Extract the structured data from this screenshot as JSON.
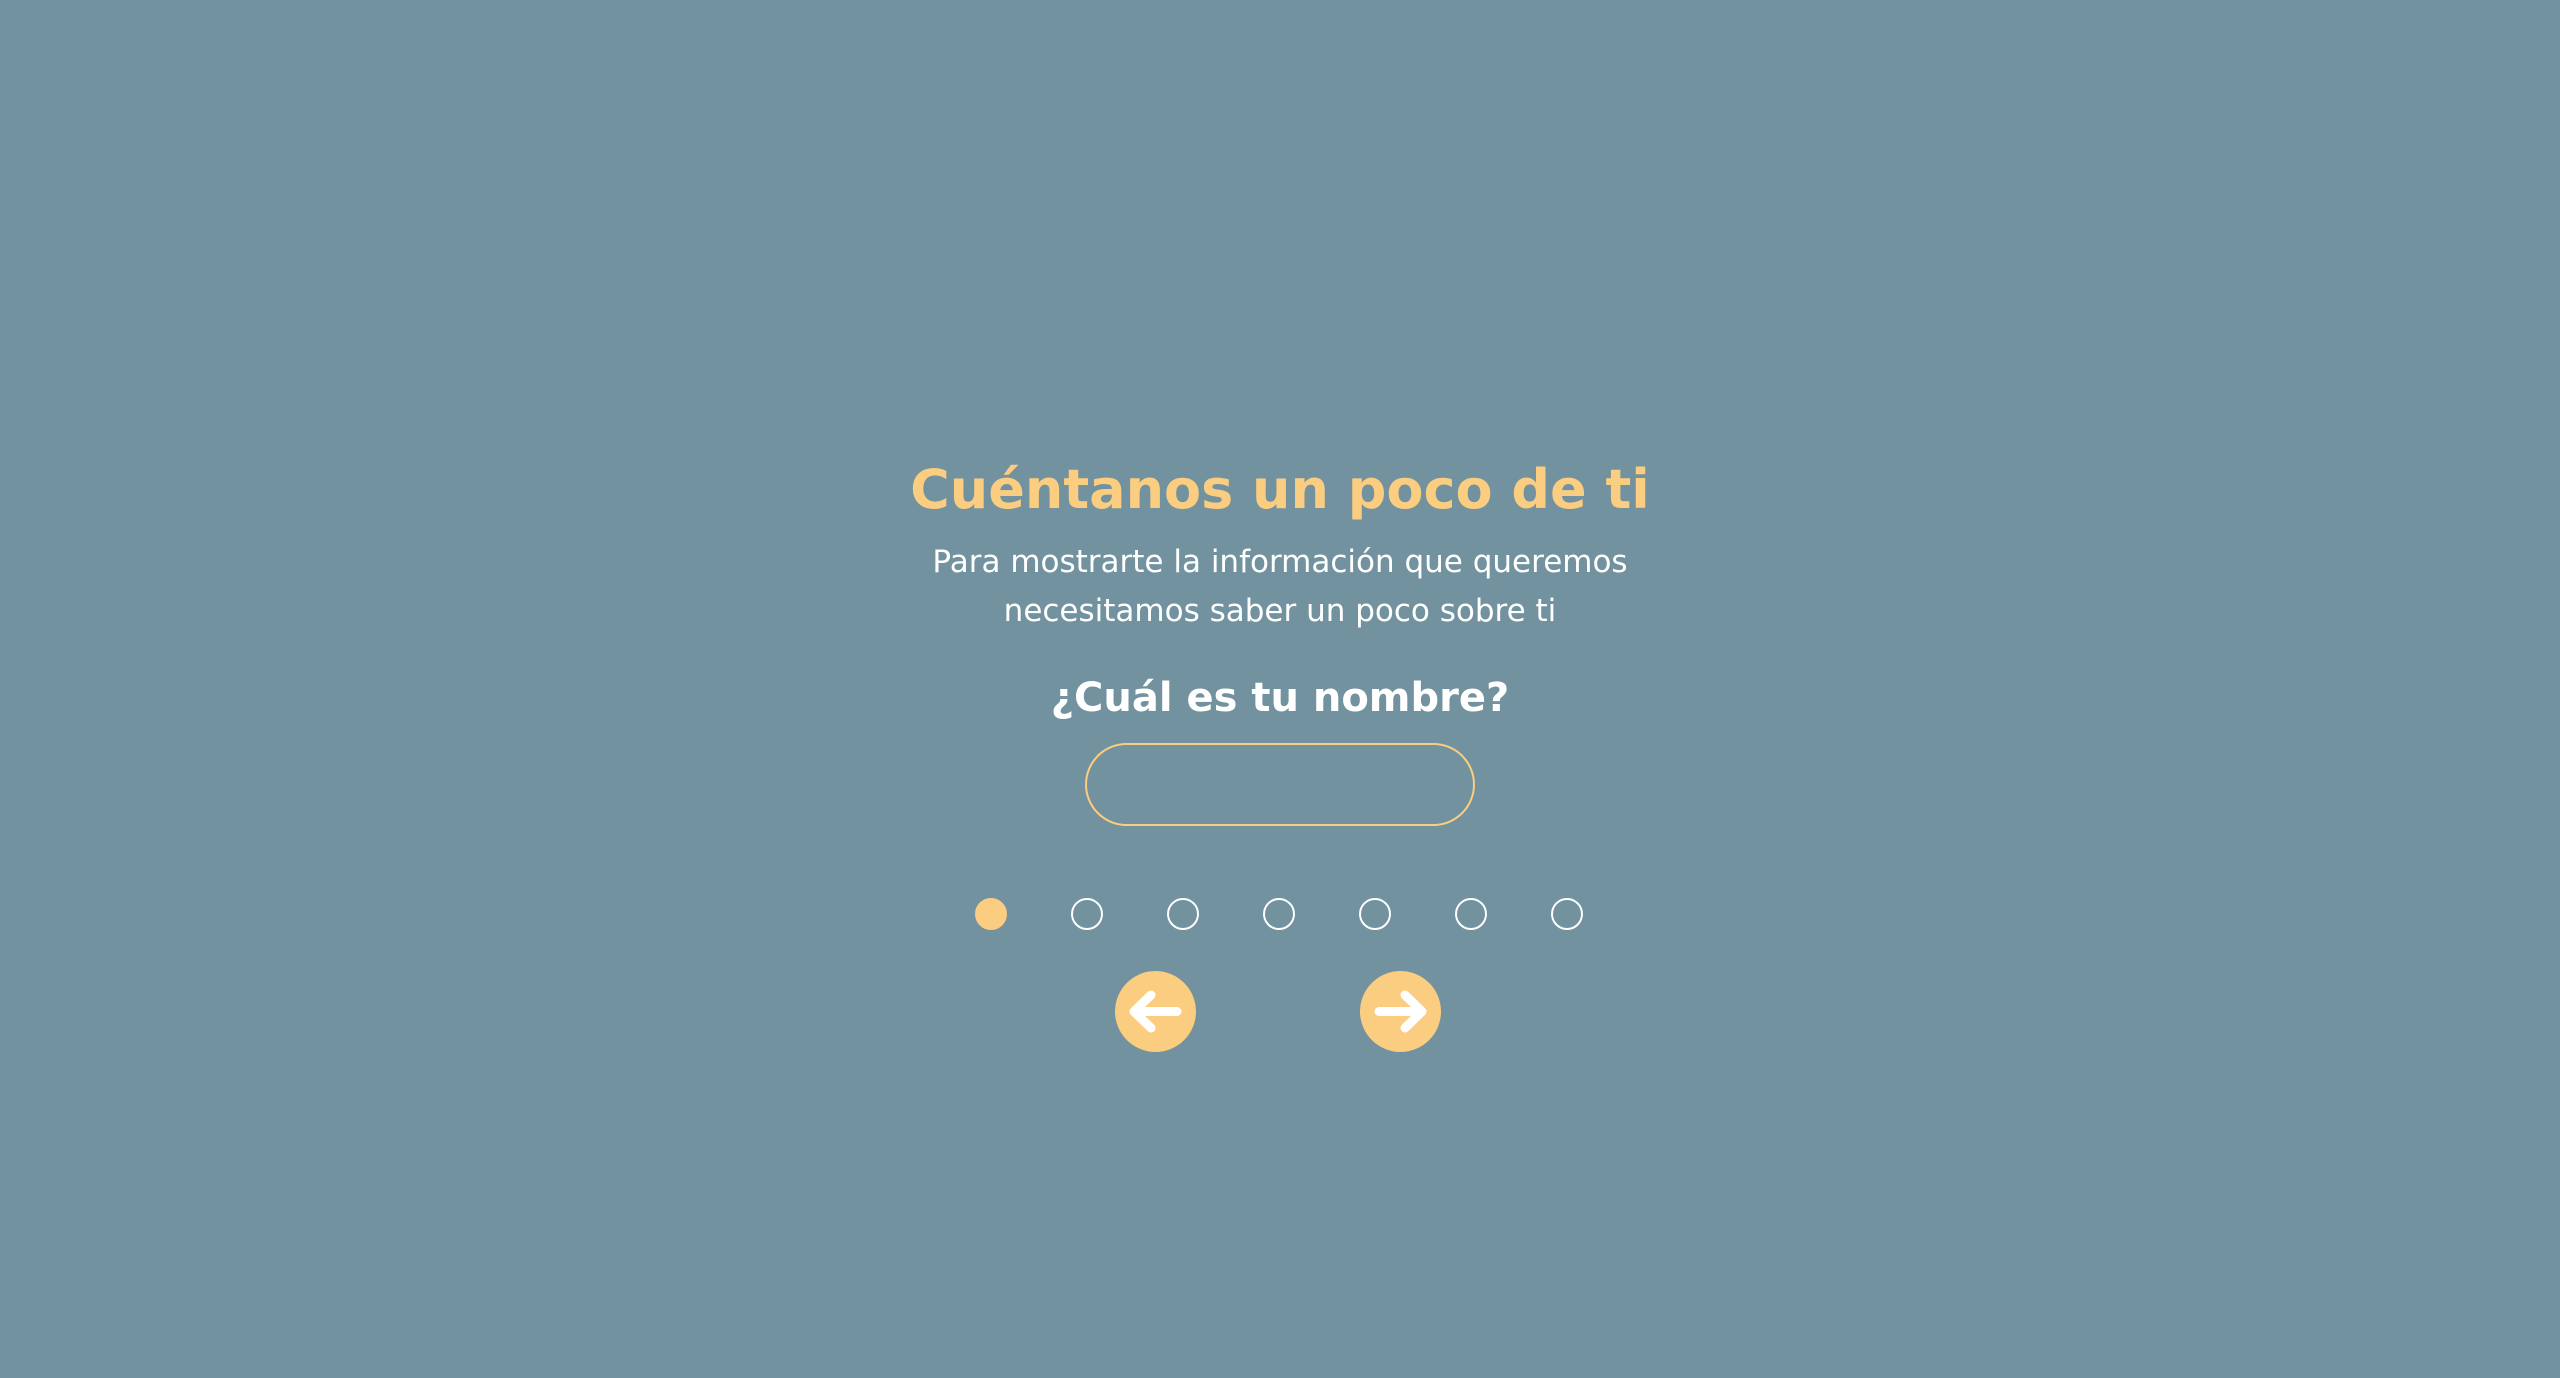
{
  "colors": {
    "background": "#71929e",
    "accent": "#fbcd81",
    "text": "#ffffff"
  },
  "header": {
    "title": "Cuéntanos un poco de ti",
    "subtitle": "Para mostrarte la información que queremos necesitamos saber un poco sobre ti"
  },
  "form": {
    "question": "¿Cuál es tu nombre?",
    "name_value": "",
    "name_placeholder": ""
  },
  "progress": {
    "total_steps": 7,
    "current_step": 1
  },
  "navigation": {
    "prev_icon": "arrow-left-icon",
    "next_icon": "arrow-right-icon"
  }
}
